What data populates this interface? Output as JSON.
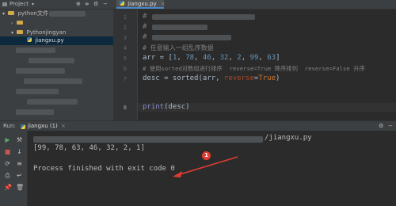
{
  "project_panel": {
    "title": "Project",
    "tree": [
      {
        "label": "python文件"
      },
      {
        "label": ""
      },
      {
        "label": "Pythonjingyan"
      },
      {
        "label": "jiangxu.py"
      }
    ]
  },
  "editor": {
    "tab_label": "jiangxu.py",
    "line_numbers": [
      "1",
      "2",
      "3",
      "4",
      "5",
      "6",
      "7",
      "8"
    ],
    "lines": {
      "l1": "#",
      "l2": "#",
      "l3": "#",
      "l4": "# 任意输入一组乱序数据",
      "l5": {
        "a": "arr = [",
        "n1": "1",
        "s1": ", ",
        "n2": "78",
        "s2": ", ",
        "n3": "46",
        "s3": ", ",
        "n4": "32",
        "s4": ", ",
        "n5": "2",
        "s5": ", ",
        "n6": "99",
        "s6": ", ",
        "n7": "63",
        "b": "]"
      },
      "l6": "# 使用sorted对数组进行排序  reverse=True 降序排列  reverse=False 升序",
      "l7": {
        "a": "desc = sorted(arr, ",
        "k": "reverse",
        "eq": "=",
        "t": "True",
        "b": ")"
      },
      "l8": {
        "f": "print",
        "a": "(desc)"
      }
    }
  },
  "run_panel": {
    "label": "Run:",
    "tab_label": "jiangxu (1)",
    "path_suffix": "/jiangxu.py",
    "output_line": "[99, 78, 63, 46, 32, 2, 1]",
    "finish_line": "Process finished with exit code 0"
  },
  "annotation": {
    "badge": "1",
    "color": "#e03c31"
  },
  "icons": [
    "play-icon",
    "stop-icon",
    "rerun-icon",
    "scroll-icon",
    "print-icon",
    "pin-icon",
    "settings-icon",
    "close-icon"
  ]
}
